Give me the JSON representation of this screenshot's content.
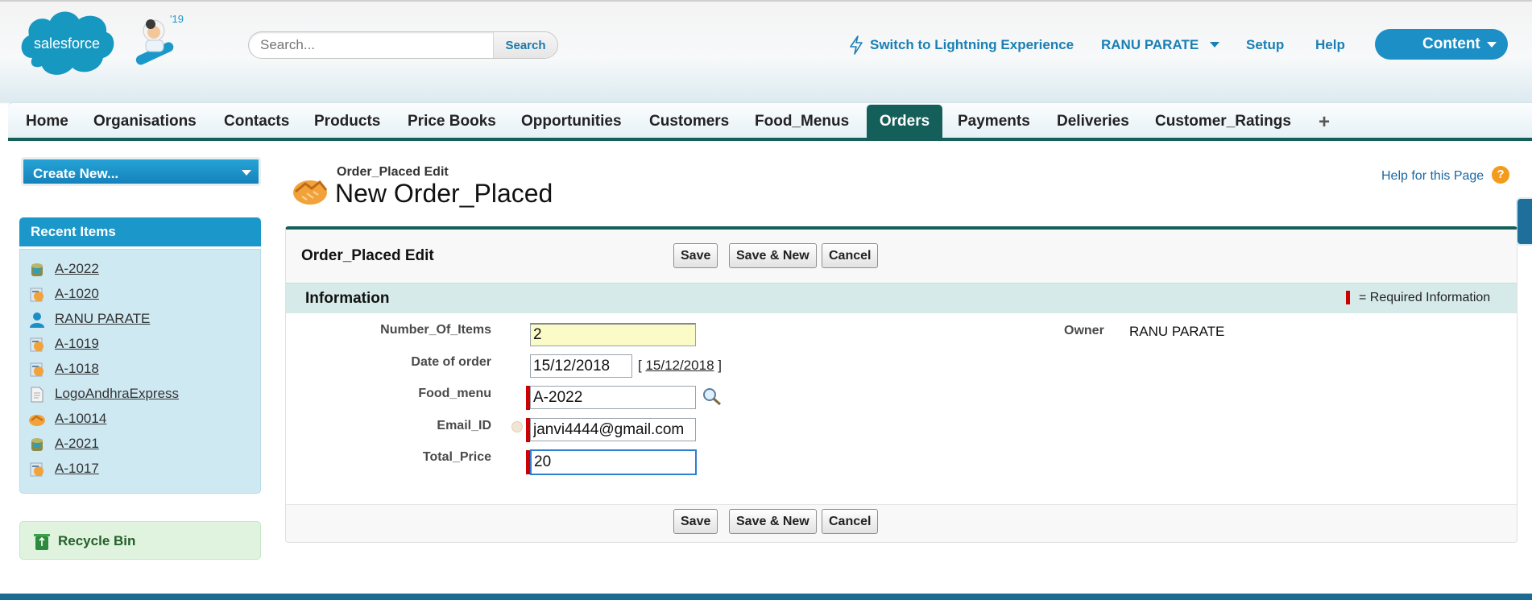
{
  "header": {
    "logo_text": "salesforce",
    "mascot_badge": "'19",
    "search_placeholder": "Search...",
    "search_button": "Search",
    "lightning_link": "Switch to Lightning Experience",
    "user_name": "RANU PARATE",
    "setup_link": "Setup",
    "help_link": "Help",
    "app_menu": "Content"
  },
  "tabs": [
    "Home",
    "Organisations",
    "Contacts",
    "Products",
    "Price Books",
    "Opportunities",
    "Customers",
    "Food_Menus",
    "Orders",
    "Payments",
    "Deliveries",
    "Customer_Ratings"
  ],
  "active_tab": "Orders",
  "tab_add": "+",
  "sidebar": {
    "create_new": "Create New...",
    "recent_title": "Recent Items",
    "recent_items": [
      {
        "label": "A-2022",
        "icon": "food-menu-icon"
      },
      {
        "label": "A-1020",
        "icon": "order-icon"
      },
      {
        "label": "RANU PARATE",
        "icon": "user-icon"
      },
      {
        "label": "A-1019",
        "icon": "order-icon"
      },
      {
        "label": "A-1018",
        "icon": "order-icon"
      },
      {
        "label": "LogoAndhraExpress",
        "icon": "document-icon"
      },
      {
        "label": "A-10014",
        "icon": "handshake-icon"
      },
      {
        "label": "A-2021",
        "icon": "food-menu-icon"
      },
      {
        "label": "A-1017",
        "icon": "order-icon"
      }
    ],
    "recycle_bin": "Recycle Bin"
  },
  "page": {
    "subtitle": "Order_Placed Edit",
    "title": "New Order_Placed",
    "help_text": "Help for this Page",
    "help_icon": "?"
  },
  "form": {
    "panel_title": "Order_Placed Edit",
    "save": "Save",
    "save_new": "Save & New",
    "cancel": "Cancel",
    "section_title": "Information",
    "required_legend": "= Required Information",
    "fields": {
      "number_of_items": {
        "label": "Number_Of_Items",
        "value": "2"
      },
      "date_of_order": {
        "label": "Date of order",
        "value": "15/12/2018",
        "today_link": "15/12/2018"
      },
      "food_menu": {
        "label": "Food_menu",
        "value": "A-2022"
      },
      "email_id": {
        "label": "Email_ID",
        "value": "janvi4444@gmail.com"
      },
      "total_price": {
        "label": "Total_Price",
        "value": "20"
      }
    },
    "owner": {
      "label": "Owner",
      "value": "RANU PARATE"
    }
  },
  "colors": {
    "brand_blue": "#1b8fc6",
    "tab_active": "#145f59",
    "required_red": "#cc0000",
    "highlight_yellow": "#fbfbc8"
  }
}
